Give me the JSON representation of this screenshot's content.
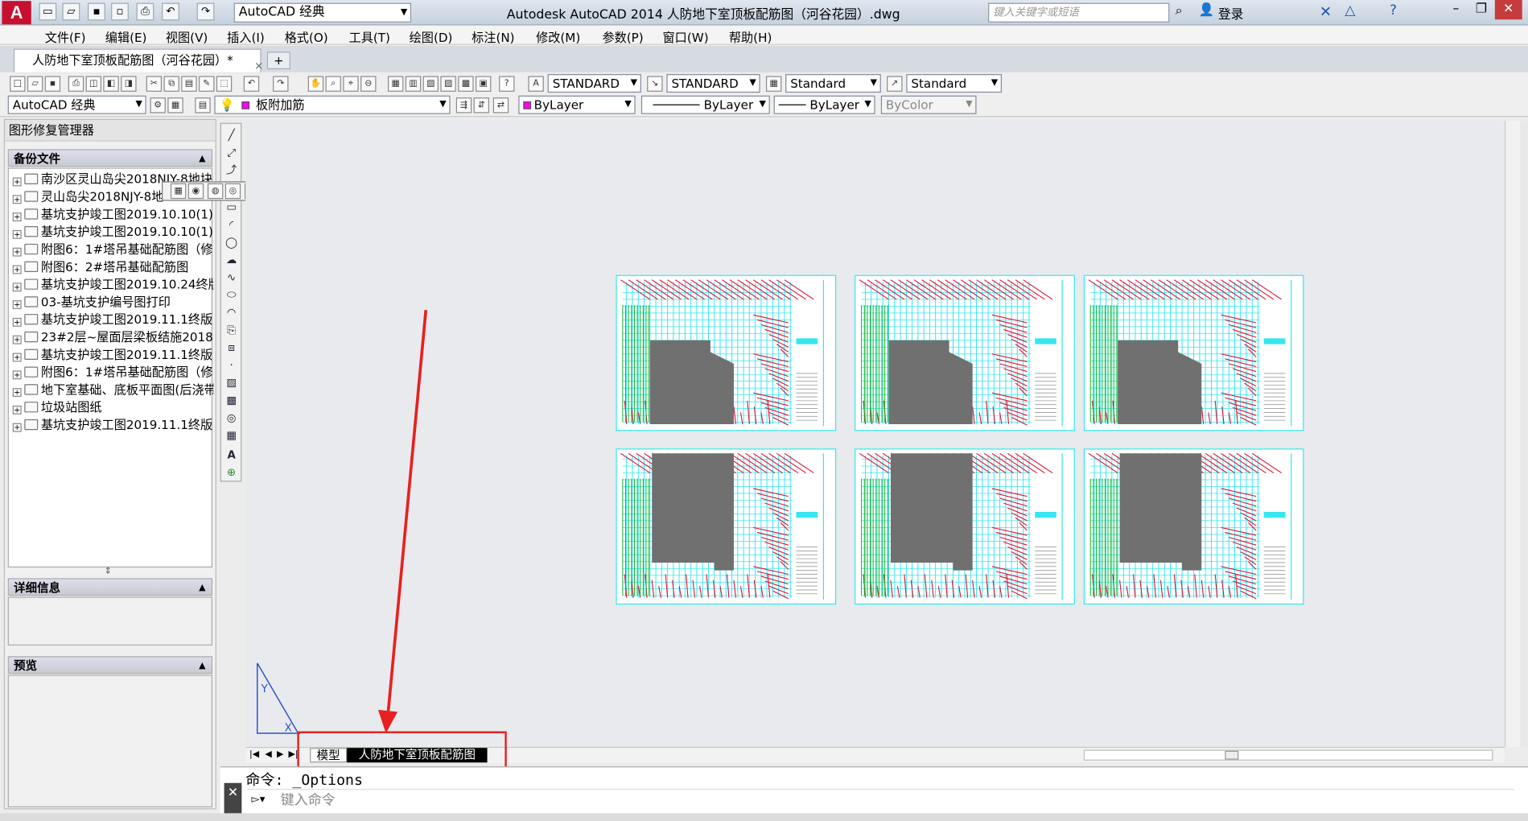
{
  "titlebar": {
    "logo": "A",
    "workspace": "AutoCAD 经典",
    "title": "Autodesk AutoCAD 2014    人防地下室顶板配筋图（河谷花园）.dwg",
    "search_placeholder": "键入关键字或短语",
    "login": "登录"
  },
  "menubar": [
    "文件(F)",
    "编辑(E)",
    "视图(V)",
    "插入(I)",
    "格式(O)",
    "工具(T)",
    "绘图(D)",
    "标注(N)",
    "修改(M)",
    "参数(P)",
    "窗口(W)",
    "帮助(H)"
  ],
  "doc_tab": {
    "label": "人防地下室顶板配筋图（河谷花园）*",
    "close": "×",
    "new": "+"
  },
  "toolbar": {
    "text_style": "STANDARD",
    "dim_style": "STANDARD",
    "table_style": "Standard",
    "mleader_style": "Standard",
    "workspace2": "AutoCAD 经典",
    "layer": "板附加筋",
    "color": "ByLayer",
    "linetype": "ByLayer",
    "lineweight": "ByLayer",
    "plotstyle": "ByColor"
  },
  "palette": {
    "title": "图形修复管理器",
    "backup_header": "备份文件",
    "files": [
      "南沙区灵山岛尖2018NJY-8地块",
      "灵山岛尖2018NJY-8地",
      "基坑支护竣工图2019.10.10(1)(",
      "基坑支护竣工图2019.10.10(1)(",
      "附图6：1#塔吊基础配筋图（修",
      "附图6：2#塔吊基础配筋图",
      "基坑支护竣工图2019.10.24终版",
      "03-基坑支护编号图打印",
      "基坑支护竣工图2019.11.1终版",
      "23#2层~屋面层梁板结施20181",
      "基坑支护竣工图2019.11.1终版(",
      "附图6：1#塔吊基础配筋图（修",
      "地下室基础、底板平面图(后浇带",
      "垃圾站图纸",
      "基坑支护竣工图2019.11.1终版("
    ],
    "details_header": "详细信息",
    "preview_header": "预览"
  },
  "layout_tabs": {
    "model": "模型",
    "layout": "人防地下室顶板配筋图"
  },
  "command": {
    "history": "命令: _Options",
    "placeholder": "键入命令"
  },
  "colors": {
    "highlight": "#e8201f",
    "sheet_border": "#2ee9ef",
    "logo": "#c8102e"
  }
}
